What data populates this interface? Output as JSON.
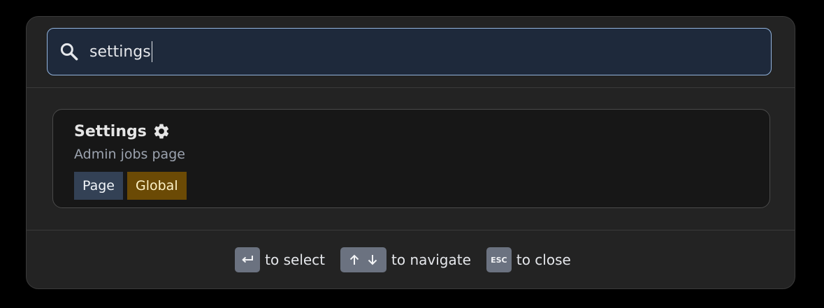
{
  "search": {
    "value": "settings",
    "icon": "search-icon"
  },
  "results": [
    {
      "title": "Settings",
      "icon": "gear-icon",
      "subtitle": "Admin jobs page",
      "tags": [
        {
          "label": "Page",
          "color": "#334155"
        },
        {
          "label": "Global",
          "color": "#6b4a05"
        }
      ]
    }
  ],
  "footer": {
    "select": {
      "key": "enter-key-icon",
      "label": "to select"
    },
    "navigate": {
      "keys": [
        "arrow-up-icon",
        "arrow-down-icon"
      ],
      "label": "to navigate"
    },
    "close": {
      "key": "ESC",
      "label": "to close"
    }
  },
  "colors": {
    "background": "#000000",
    "panel": "#232323",
    "accent_border": "#93b4dd",
    "search_bg": "#1e293b"
  }
}
